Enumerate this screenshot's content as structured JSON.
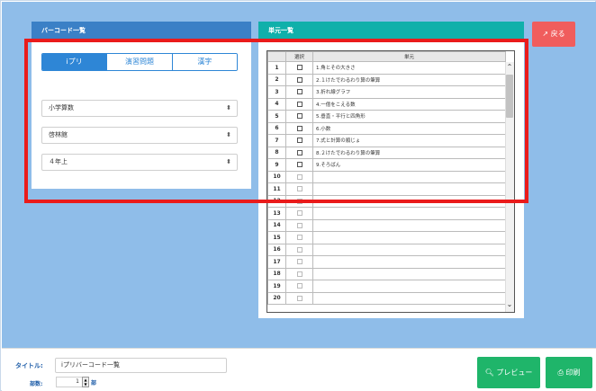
{
  "left_panel": {
    "header": "バーコード一覧",
    "tabs": [
      "iプリ",
      "演習問題",
      "漢字"
    ],
    "selects": [
      "小学算数",
      "啓林館",
      "４年上"
    ]
  },
  "right_panel": {
    "header": "単元一覧",
    "columns": {
      "select": "選択",
      "unit": "単元"
    },
    "rows": [
      {
        "num": "1",
        "unit": "1.角とその大きさ"
      },
      {
        "num": "2",
        "unit": "2.１けたでわるわり算の筆算"
      },
      {
        "num": "3",
        "unit": "3.折れ線グラフ"
      },
      {
        "num": "4",
        "unit": "4.一億をこえる数"
      },
      {
        "num": "5",
        "unit": "5.垂直・平行と四角形"
      },
      {
        "num": "6",
        "unit": "6.小数"
      },
      {
        "num": "7",
        "unit": "7.式と計算の順じょ"
      },
      {
        "num": "8",
        "unit": "8.２けたでわるわり算の筆算"
      },
      {
        "num": "9",
        "unit": "9.そろばん"
      },
      {
        "num": "10",
        "unit": ""
      },
      {
        "num": "11",
        "unit": ""
      },
      {
        "num": "12",
        "unit": ""
      },
      {
        "num": "13",
        "unit": ""
      },
      {
        "num": "14",
        "unit": ""
      },
      {
        "num": "15",
        "unit": ""
      },
      {
        "num": "16",
        "unit": ""
      },
      {
        "num": "17",
        "unit": ""
      },
      {
        "num": "18",
        "unit": ""
      },
      {
        "num": "19",
        "unit": ""
      },
      {
        "num": "20",
        "unit": ""
      }
    ]
  },
  "back_button": {
    "label": "戻る",
    "icon": "sign-out-icon"
  },
  "footer": {
    "title_label": "タイトル:",
    "title_value": "iプリバーコード一覧",
    "copies_label": "部数:",
    "copies_value": "1",
    "copies_unit": "部",
    "preview_label": "プレビュー",
    "print_label": "印刷"
  },
  "colors": {
    "background": "#8fbde9",
    "left_header": "#3b80c6",
    "right_header": "#10b0aa",
    "accent_blue": "#2e86d6",
    "back_button": "#f05d5d",
    "green_button": "#1fb56a",
    "highlight": "#ea1b1b"
  }
}
